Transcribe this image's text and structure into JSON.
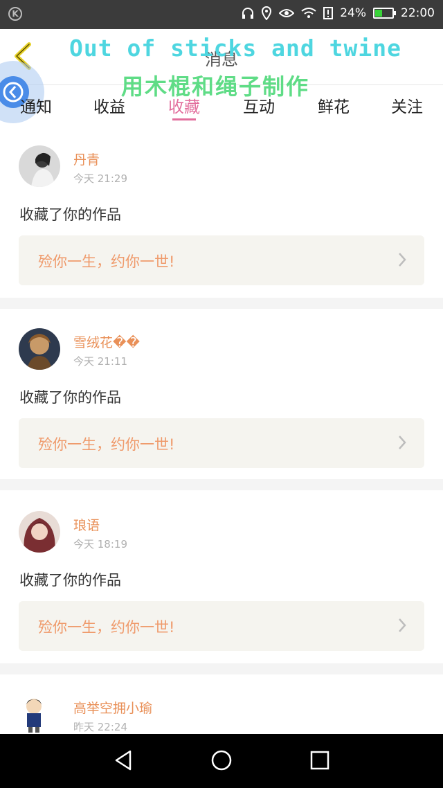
{
  "status_bar": {
    "battery_percent": "24%",
    "time": "22:00",
    "icons": [
      "headset-icon",
      "location-icon",
      "eye-icon",
      "wifi-icon",
      "alert-icon"
    ]
  },
  "header": {
    "title": "消息",
    "watermark_en": "Out of sticks and twine",
    "watermark_cn": "用木棍和绳子制作"
  },
  "tabs": [
    {
      "label": "通知"
    },
    {
      "label": "收益"
    },
    {
      "label": "收藏"
    },
    {
      "label": "互动"
    },
    {
      "label": "鲜花"
    },
    {
      "label": "关注"
    }
  ],
  "active_tab": "收藏",
  "messages": [
    {
      "name": "丹青",
      "time": "今天 21:29",
      "action": "收藏了你的作品",
      "work": "殓你一生，约你一世!"
    },
    {
      "name": "雪绒花��",
      "time": "今天 21:11",
      "action": "收藏了你的作品",
      "work": "殓你一生，约你一世!"
    },
    {
      "name": "琅语",
      "time": "今天 18:19",
      "action": "收藏了你的作品",
      "work": "殓你一生，约你一世!"
    },
    {
      "name": "高举空拥小瑜",
      "time": "昨天 22:24"
    }
  ],
  "colors": {
    "accent": "#e26d9c",
    "name": "#e99058",
    "quote": "#ef9a6b"
  }
}
